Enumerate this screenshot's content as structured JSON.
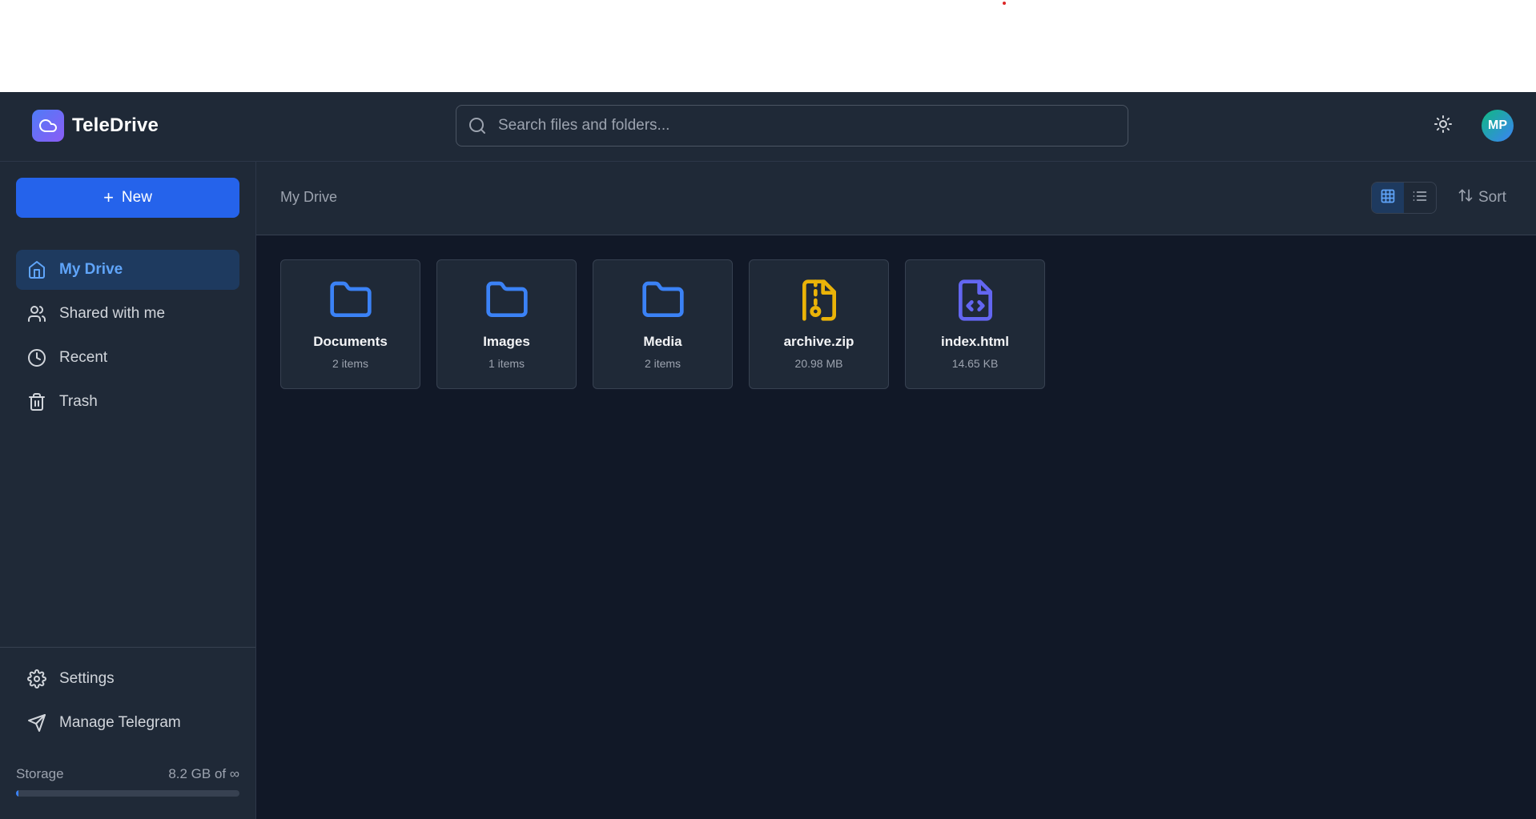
{
  "app": {
    "name": "TeleDrive",
    "logo_icon": "cloud-icon",
    "accent_color": "#2563eb"
  },
  "header": {
    "search_placeholder": "Search files and folders...",
    "search_icon": "search-icon",
    "theme_icon": "sun-icon",
    "avatar_initials": "MP"
  },
  "sidebar": {
    "new_label": "New",
    "items": [
      {
        "label": "My Drive",
        "icon": "home-icon",
        "active": true
      },
      {
        "label": "Shared with me",
        "icon": "users-icon",
        "active": false
      },
      {
        "label": "Recent",
        "icon": "clock-icon",
        "active": false
      },
      {
        "label": "Trash",
        "icon": "trash-icon",
        "active": false
      }
    ],
    "bottom_items": [
      {
        "label": "Settings",
        "icon": "gear-icon"
      },
      {
        "label": "Manage Telegram",
        "icon": "send-icon"
      }
    ],
    "storage": {
      "label": "Storage",
      "value": "8.2 GB of ∞",
      "fill_fraction": 0.01
    }
  },
  "toolbar": {
    "breadcrumb": "My Drive",
    "view_mode": "grid",
    "sort_label": "Sort"
  },
  "files": [
    {
      "name": "Documents",
      "meta": "2 items",
      "type": "folder",
      "color": "#3b82f6"
    },
    {
      "name": "Images",
      "meta": "1 items",
      "type": "folder",
      "color": "#3b82f6"
    },
    {
      "name": "Media",
      "meta": "2 items",
      "type": "folder",
      "color": "#3b82f6"
    },
    {
      "name": "archive.zip",
      "meta": "20.98 MB",
      "type": "zip",
      "color": "#eab308"
    },
    {
      "name": "index.html",
      "meta": "14.65 KB",
      "type": "code",
      "color": "#6366f1"
    }
  ]
}
